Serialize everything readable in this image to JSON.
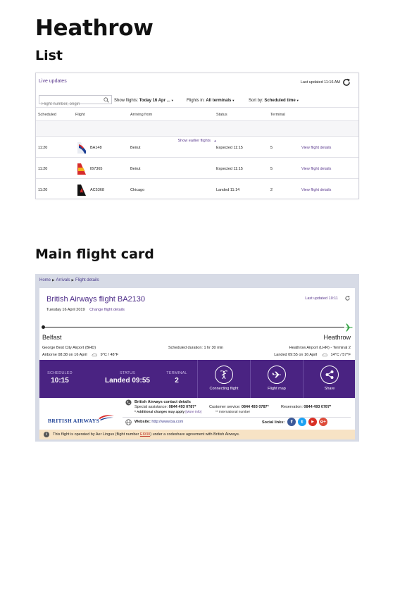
{
  "doc": {
    "title": "Heathrow",
    "section_list": "List",
    "section_card": "Main flight card"
  },
  "list": {
    "live_updates": "Live updates",
    "last_updated": "Last updated 11:16 AM",
    "search_placeholder": "Flight number, origin",
    "show_flights_label": "Show flights:",
    "show_flights_value": "Today 16 Apr ...",
    "flights_in_label": "Flights in:",
    "flights_in_value": "All terminals",
    "sort_by_label": "Sort by:",
    "sort_by_value": "Scheduled time",
    "columns": {
      "scheduled": "Scheduled",
      "flight": "Flight",
      "arriving_from": "Arriving from",
      "status": "Status",
      "terminal": "Terminal"
    },
    "show_earlier": "Show earlier flights",
    "rows": [
      {
        "scheduled": "11:20",
        "flight": "BA148",
        "from": "Beirut",
        "status": "Expected 11:15",
        "terminal": "5",
        "link": "View flight details",
        "airline_colors": [
          "#d92b2b",
          "#1c3f94"
        ]
      },
      {
        "scheduled": "11:20",
        "flight": "IB7365",
        "from": "Beirut",
        "status": "Expected 11:15",
        "terminal": "5",
        "link": "View flight details",
        "airline_colors": [
          "#d62b2b",
          "#f2b21c"
        ]
      },
      {
        "scheduled": "11:20",
        "flight": "AC5368",
        "from": "Chicago",
        "status": "Landed 11:14",
        "terminal": "2",
        "link": "View flight details",
        "airline_colors": [
          "#111111",
          "#d62b2b"
        ]
      }
    ]
  },
  "card": {
    "breadcrumb": [
      "Home",
      "Arrivals",
      "Flight details"
    ],
    "title": "British Airways flight BA2130",
    "date": "Tuesday 16 April 2019",
    "change_link": "Change flight details",
    "last_updated": "Last updated 10:11",
    "from_city": "Belfast",
    "to_city": "Heathrow",
    "from_airport": "George Best City Airport (BHD)",
    "scheduled_duration": "Scheduled duration: 1 hr 30 min",
    "to_airport": "Heathrow Airport (LHR) - Terminal 2",
    "airborne": "Airborne 08:38 on 16 April",
    "from_weather": "9°C / 48°F",
    "landed": "Landed 09:55 on 16 April",
    "to_weather": "14°C / 57°F",
    "scheduled_label": "SCHEDULED",
    "scheduled_value": "10:15",
    "status_label": "STATUS",
    "status_value": "Landed 09:55",
    "terminal_label": "TERMINAL",
    "terminal_value": "2",
    "btn_connecting": "Connecting flight",
    "btn_map": "Flight map",
    "btn_share": "Share",
    "airline_logo_text": "BRITISH AIRWAYS",
    "contact_title": "British Airways contact details",
    "special_assistance_label": "Special assistance:",
    "special_assistance_value": "0844 493 0787*",
    "customer_service_label": "Customer service:",
    "customer_service_value": "0844 493 0787*",
    "reservation_label": "Reservation:",
    "reservation_value": "0844 493 0787*",
    "note_charges": "* Additional charges may apply",
    "note_more_info": "[More info]",
    "note_international": "** International number",
    "website_label": "Website:",
    "website_url": "http://www.ba.com",
    "social_label": "Social links:",
    "social": [
      {
        "icon": "facebook-icon",
        "glyph": "f",
        "color": "#3b5998"
      },
      {
        "icon": "twitter-icon",
        "glyph": "t",
        "color": "#1da1f2"
      },
      {
        "icon": "youtube-icon",
        "glyph": "▶",
        "color": "#d93025"
      },
      {
        "icon": "googleplus-icon",
        "glyph": "g+",
        "color": "#dd4b39"
      }
    ],
    "codeshare_pre": "This flight is operated by Aer Lingus (flight number ",
    "codeshare_flight": "EI930",
    "codeshare_post": ") under a codeshare agreement with British Airways.",
    "accent_color": "#4a2382",
    "codeshare_bg": "#f7e3c5"
  }
}
